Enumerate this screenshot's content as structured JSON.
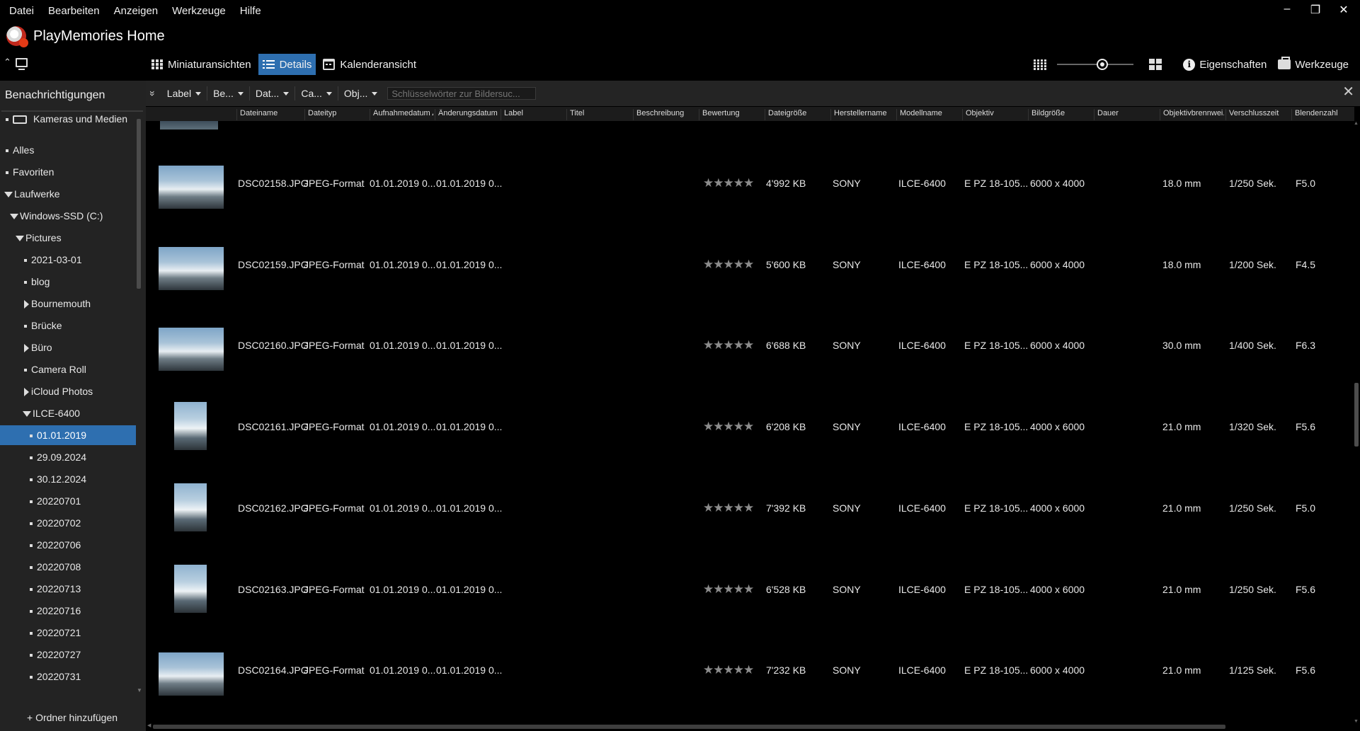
{
  "menu": [
    "Datei",
    "Bearbeiten",
    "Anzeigen",
    "Werkzeuge",
    "Hilfe"
  ],
  "window_controls": {
    "minimize": "–",
    "restore": "❐",
    "close": "✕"
  },
  "app": {
    "title": "PlayMemories Home"
  },
  "view_tabs": [
    {
      "label": "Miniaturansichten",
      "icon": "grid-icon",
      "active": false
    },
    {
      "label": "Details",
      "icon": "list-icon",
      "active": true
    },
    {
      "label": "Kalenderansicht",
      "icon": "calendar-icon",
      "active": false
    }
  ],
  "right_tools": {
    "properties": "Eigenschaften",
    "tools": "Werkzeuge",
    "zoom_level": 0.6
  },
  "sidebar": {
    "header": "Benachrichtigungen",
    "add_folder": "+ Ordner hinzufügen",
    "items": [
      {
        "label": "Kameras und Medien",
        "type": "camera"
      },
      {
        "label": "Alles",
        "type": "bullet"
      },
      {
        "label": "Favoriten",
        "type": "bullet"
      },
      {
        "label": "Laufwerke",
        "type": "expanded"
      },
      {
        "label": "Windows-SSD (C:)",
        "type": "expanded"
      },
      {
        "label": "Pictures",
        "type": "expanded"
      },
      {
        "label": "2021-03-01",
        "type": "bullet"
      },
      {
        "label": "blog",
        "type": "bullet"
      },
      {
        "label": "Bournemouth",
        "type": "collapsed"
      },
      {
        "label": "Brücke",
        "type": "bullet"
      },
      {
        "label": "Büro",
        "type": "collapsed"
      },
      {
        "label": "Camera Roll",
        "type": "bullet"
      },
      {
        "label": "iCloud Photos",
        "type": "collapsed"
      },
      {
        "label": "ILCE-6400",
        "type": "expanded"
      },
      {
        "label": "01.01.2019",
        "type": "bullet",
        "selected": true
      },
      {
        "label": "29.09.2024",
        "type": "bullet"
      },
      {
        "label": "30.12.2024",
        "type": "bullet"
      },
      {
        "label": "20220701",
        "type": "bullet"
      },
      {
        "label": "20220702",
        "type": "bullet"
      },
      {
        "label": "20220706",
        "type": "bullet"
      },
      {
        "label": "20220708",
        "type": "bullet"
      },
      {
        "label": "20220713",
        "type": "bullet"
      },
      {
        "label": "20220716",
        "type": "bullet"
      },
      {
        "label": "20220721",
        "type": "bullet"
      },
      {
        "label": "20220727",
        "type": "bullet"
      },
      {
        "label": "20220731",
        "type": "bullet"
      }
    ]
  },
  "filters": {
    "dropdowns": [
      "Label",
      "Be...",
      "Dat...",
      "Ca...",
      "Obj..."
    ],
    "search_placeholder": "Schlüsselwörter zur Bildersuc..."
  },
  "columns": [
    "Dateiname",
    "Dateityp",
    "Aufnahmedatum",
    "Änderungsdatum",
    "Label",
    "Titel",
    "Beschreibung",
    "Bewertung",
    "Dateigröße",
    "Herstellername",
    "Modellname",
    "Objektiv",
    "Bildgröße",
    "Dauer",
    "Objektivbrennwei...",
    "Verschlusszeit",
    "Blendenzahl"
  ],
  "rows": [
    {
      "filename": "DSC02158.JPG",
      "type": "JPEG-Format",
      "taken": "01.01.2019 0...",
      "modified": "01.01.2019 0...",
      "rating": 5,
      "size": "4'992 KB",
      "maker": "SONY",
      "model": "ILCE-6400",
      "lens": "E PZ 18-105...",
      "dims": "6000 x 4000",
      "focal": "18.0 mm",
      "shutter": "1/250 Sek.",
      "aperture": "F5.0",
      "orientation": "landscape"
    },
    {
      "filename": "DSC02159.JPG",
      "type": "JPEG-Format",
      "taken": "01.01.2019 0...",
      "modified": "01.01.2019 0...",
      "rating": 5,
      "size": "5'600 KB",
      "maker": "SONY",
      "model": "ILCE-6400",
      "lens": "E PZ 18-105...",
      "dims": "6000 x 4000",
      "focal": "18.0 mm",
      "shutter": "1/200 Sek.",
      "aperture": "F4.5",
      "orientation": "landscape"
    },
    {
      "filename": "DSC02160.JPG",
      "type": "JPEG-Format",
      "taken": "01.01.2019 0...",
      "modified": "01.01.2019 0...",
      "rating": 5,
      "size": "6'688 KB",
      "maker": "SONY",
      "model": "ILCE-6400",
      "lens": "E PZ 18-105...",
      "dims": "6000 x 4000",
      "focal": "30.0 mm",
      "shutter": "1/400 Sek.",
      "aperture": "F6.3",
      "orientation": "landscape"
    },
    {
      "filename": "DSC02161.JPG",
      "type": "JPEG-Format",
      "taken": "01.01.2019 0...",
      "modified": "01.01.2019 0...",
      "rating": 5,
      "size": "6'208 KB",
      "maker": "SONY",
      "model": "ILCE-6400",
      "lens": "E PZ 18-105...",
      "dims": "4000 x 6000",
      "focal": "21.0 mm",
      "shutter": "1/320 Sek.",
      "aperture": "F5.6",
      "orientation": "portrait"
    },
    {
      "filename": "DSC02162.JPG",
      "type": "JPEG-Format",
      "taken": "01.01.2019 0...",
      "modified": "01.01.2019 0...",
      "rating": 5,
      "size": "7'392 KB",
      "maker": "SONY",
      "model": "ILCE-6400",
      "lens": "E PZ 18-105...",
      "dims": "4000 x 6000",
      "focal": "21.0 mm",
      "shutter": "1/250 Sek.",
      "aperture": "F5.0",
      "orientation": "portrait"
    },
    {
      "filename": "DSC02163.JPG",
      "type": "JPEG-Format",
      "taken": "01.01.2019 0...",
      "modified": "01.01.2019 0...",
      "rating": 5,
      "size": "6'528 KB",
      "maker": "SONY",
      "model": "ILCE-6400",
      "lens": "E PZ 18-105...",
      "dims": "4000 x 6000",
      "focal": "21.0 mm",
      "shutter": "1/250 Sek.",
      "aperture": "F5.6",
      "orientation": "portrait"
    },
    {
      "filename": "DSC02164.JPG",
      "type": "JPEG-Format",
      "taken": "01.01.2019 0...",
      "modified": "01.01.2019 0...",
      "rating": 5,
      "size": "7'232 KB",
      "maker": "SONY",
      "model": "ILCE-6400",
      "lens": "E PZ 18-105...",
      "dims": "6000 x 4000",
      "focal": "21.0 mm",
      "shutter": "1/125 Sek.",
      "aperture": "F5.6",
      "orientation": "landscape"
    }
  ],
  "colors": {
    "accent": "#2e6fb0",
    "background": "#000000",
    "sidebar": "#232323",
    "star": "#8c8c8c"
  }
}
